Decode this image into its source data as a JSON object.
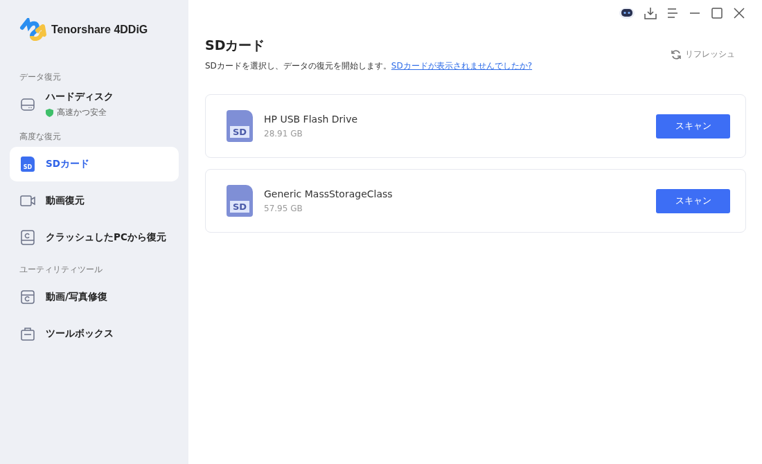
{
  "app": {
    "name": "Tenorshare 4DDiG"
  },
  "sidebar": {
    "groups": [
      {
        "heading": "データ復元",
        "items": [
          {
            "label": "ハードディスク",
            "badge": "高速かつ安全",
            "selected": false
          }
        ]
      },
      {
        "heading": "高度な復元",
        "items": [
          {
            "label": "SDカード",
            "icon_label": "SD",
            "selected": true
          },
          {
            "label": "動画復元",
            "selected": false
          },
          {
            "label": "クラッシュしたPCから復元",
            "selected": false
          }
        ]
      },
      {
        "heading": "ユーティリティツール",
        "items": [
          {
            "label": "動画/写真修復",
            "selected": false
          },
          {
            "label": "ツールボックス",
            "selected": false
          }
        ]
      }
    ]
  },
  "main": {
    "title": "SDカード",
    "description": "SDカードを選択し、データの復元を開始します。",
    "help_link": "SDカードが表示されませんでしたか?",
    "refresh": "リフレッシュ",
    "drives": [
      {
        "name": "HP USB Flash Drive",
        "size": "28.91 GB",
        "icon_label": "SD",
        "button": "スキャン"
      },
      {
        "name": "Generic MassStorageClass",
        "size": "57.95 GB",
        "icon_label": "SD",
        "button": "スキャン"
      }
    ]
  }
}
